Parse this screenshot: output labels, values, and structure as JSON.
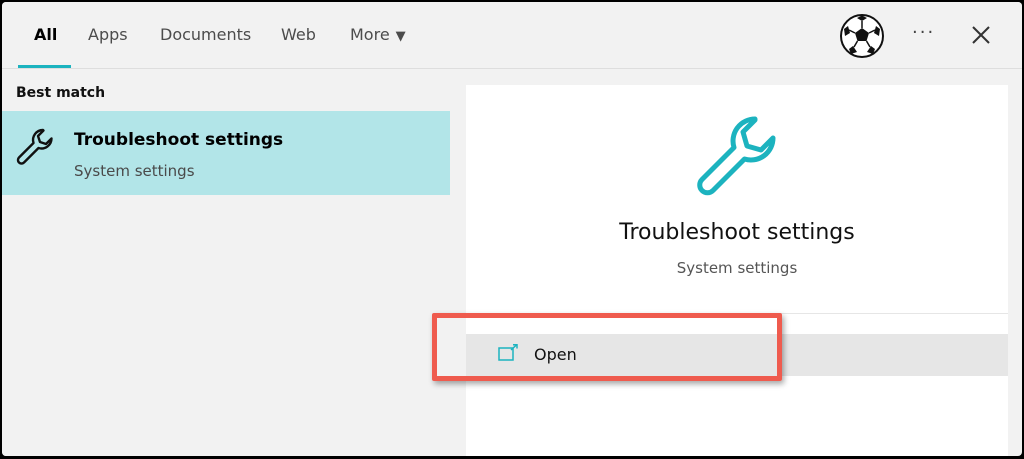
{
  "tabs": [
    {
      "label": "All"
    },
    {
      "label": "Apps"
    },
    {
      "label": "Documents"
    },
    {
      "label": "Web"
    },
    {
      "label": "More"
    }
  ],
  "toolbar": {
    "more_options_icon": "ellipsis-icon",
    "close_icon": "close-icon",
    "avatar_icon": "soccer-ball-avatar",
    "more_options_label": "···"
  },
  "left": {
    "section_label": "Best match",
    "result": {
      "title": "Troubleshoot settings",
      "subtitle": "System settings",
      "icon": "wrench-icon"
    }
  },
  "detail": {
    "title": "Troubleshoot settings",
    "subtitle": "System settings",
    "icon": "wrench-icon",
    "actions": [
      {
        "label": "Open",
        "icon": "open-window-icon"
      }
    ]
  },
  "colors": {
    "accent": "#1cb3bf",
    "selection": "#b2e5e8",
    "highlight_box": "#ef5b4e"
  }
}
